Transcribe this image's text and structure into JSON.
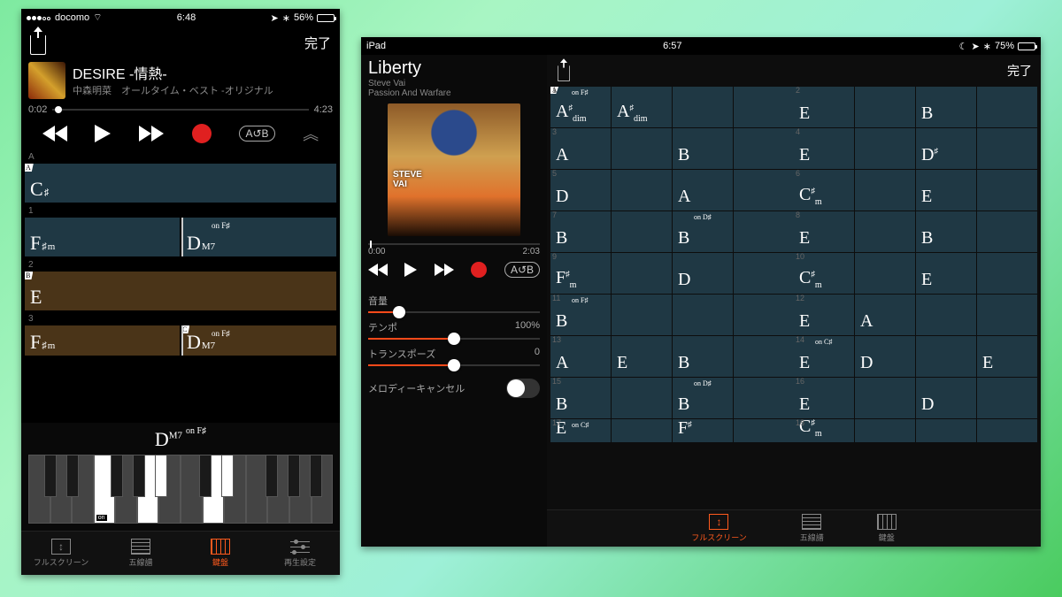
{
  "iphone": {
    "carrier": "docomo",
    "time": "6:48",
    "battery_pct": "56%",
    "done": "完了",
    "song_title": "DESIRE -情熱-",
    "song_sub": "中森明菜　オールタイム・ベスト -オリジナル",
    "time_cur": "0:02",
    "time_total": "4:23",
    "ab_label": "A↺B",
    "rows": {
      "r_a": "A",
      "r_a_corner": "A",
      "c_a": "C",
      "c_a_sup": "♯",
      "r1": "1",
      "r1_c1": "F",
      "r1_c1_sub": "m",
      "r1_c1_sup": "♯",
      "r1_c2": "D",
      "r1_c2_sub": "M7",
      "r1_c2_ov": "on F♯",
      "r2": "2",
      "r2_corner": "B",
      "r2_c1": "E",
      "r3": "3",
      "r3_c1": "F",
      "r3_c1_sub": "m",
      "r3_c1_sup": "♯",
      "r3_c2": "D",
      "r3_c2_sub": "M7",
      "r3_c2_ov": "on F♯",
      "r3_corner": "C"
    },
    "piano_label": "D",
    "piano_sub": "M7",
    "piano_ov": "on F♯",
    "piano_note": "on",
    "tabs": {
      "fs": "フルスクリーン",
      "staff": "五線譜",
      "piano": "鍵盤",
      "play": "再生設定"
    }
  },
  "ipad": {
    "device": "iPad",
    "time": "6:57",
    "battery_pct": "75%",
    "title": "Liberty",
    "artist": "Steve Vai",
    "album": "Passion And Warfare",
    "done": "完了",
    "time_cur": "0:00",
    "time_total": "2:03",
    "ab_label": "A↺B",
    "vol_label": "音量",
    "tempo_label": "テンポ",
    "tempo_val": "100%",
    "trans_label": "トランスポーズ",
    "trans_val": "0",
    "melody_label": "メロディーキャンセル",
    "tabs": {
      "fs": "フルスクリーン",
      "staff": "五線譜",
      "piano": "鍵盤"
    },
    "grid": [
      {
        "n1": "1",
        "n2": "2",
        "cells": [
          {
            "c": "A",
            "t": "A",
            "sup": "♯",
            "sub": "dim",
            "ov": "on F♯"
          },
          {
            "t": "A",
            "sup": "♯",
            "sub": "dim"
          },
          {
            "t": ""
          },
          {
            "t": ""
          },
          {
            "t": "E"
          },
          {
            "t": ""
          },
          {
            "t": "B"
          },
          {
            "t": ""
          }
        ]
      },
      {
        "n1": "3",
        "n2": "4",
        "cells": [
          {
            "t": "A"
          },
          {
            "t": ""
          },
          {
            "t": "B"
          },
          {
            "t": ""
          },
          {
            "t": "E"
          },
          {
            "t": ""
          },
          {
            "t": "D",
            "sup": "♯"
          },
          {
            "t": ""
          }
        ]
      },
      {
        "n1": "5",
        "n2": "6",
        "cells": [
          {
            "t": "D"
          },
          {
            "t": ""
          },
          {
            "t": "A"
          },
          {
            "t": ""
          },
          {
            "t": "C",
            "sup": "♯",
            "sub": "m"
          },
          {
            "t": ""
          },
          {
            "t": "E"
          },
          {
            "t": ""
          }
        ]
      },
      {
        "n1": "7",
        "n2": "8",
        "cells": [
          {
            "t": "B"
          },
          {
            "t": ""
          },
          {
            "t": "B",
            "ov": "on D♯"
          },
          {
            "t": ""
          },
          {
            "t": "E"
          },
          {
            "t": ""
          },
          {
            "t": "B"
          },
          {
            "t": ""
          }
        ]
      },
      {
        "n1": "9",
        "n2": "10",
        "cells": [
          {
            "t": "F",
            "sup": "♯",
            "sub": "m"
          },
          {
            "t": ""
          },
          {
            "t": "D"
          },
          {
            "t": ""
          },
          {
            "t": "C",
            "sup": "♯",
            "sub": "m"
          },
          {
            "t": ""
          },
          {
            "t": "E"
          },
          {
            "t": ""
          }
        ]
      },
      {
        "n1": "11",
        "n2": "12",
        "cells": [
          {
            "t": "B",
            "ov": "on F♯"
          },
          {
            "t": ""
          },
          {
            "t": ""
          },
          {
            "t": ""
          },
          {
            "t": "E"
          },
          {
            "t": "A"
          },
          {
            "t": ""
          },
          {
            "t": ""
          }
        ]
      },
      {
        "n1": "13",
        "n2": "14",
        "cells": [
          {
            "t": "A"
          },
          {
            "t": "E"
          },
          {
            "t": "B"
          },
          {
            "t": ""
          },
          {
            "t": "E",
            "ov": "on C♯"
          },
          {
            "t": "D"
          },
          {
            "t": ""
          },
          {
            "t": "E"
          }
        ]
      },
      {
        "n1": "15",
        "n2": "16",
        "cells": [
          {
            "t": "B"
          },
          {
            "t": ""
          },
          {
            "t": "B",
            "ov": "on D♯"
          },
          {
            "t": ""
          },
          {
            "t": "E"
          },
          {
            "t": ""
          },
          {
            "t": "D"
          },
          {
            "t": ""
          }
        ]
      },
      {
        "n1": "17",
        "n2": "18",
        "cells": [
          {
            "t": "E",
            "ov": "on C♯"
          },
          {
            "t": ""
          },
          {
            "t": "F",
            "sup": "♯"
          },
          {
            "t": ""
          },
          {
            "t": "C",
            "sup": "♯",
            "sub": "m"
          },
          {
            "t": ""
          },
          {
            "t": ""
          },
          {
            "t": ""
          }
        ]
      }
    ]
  }
}
